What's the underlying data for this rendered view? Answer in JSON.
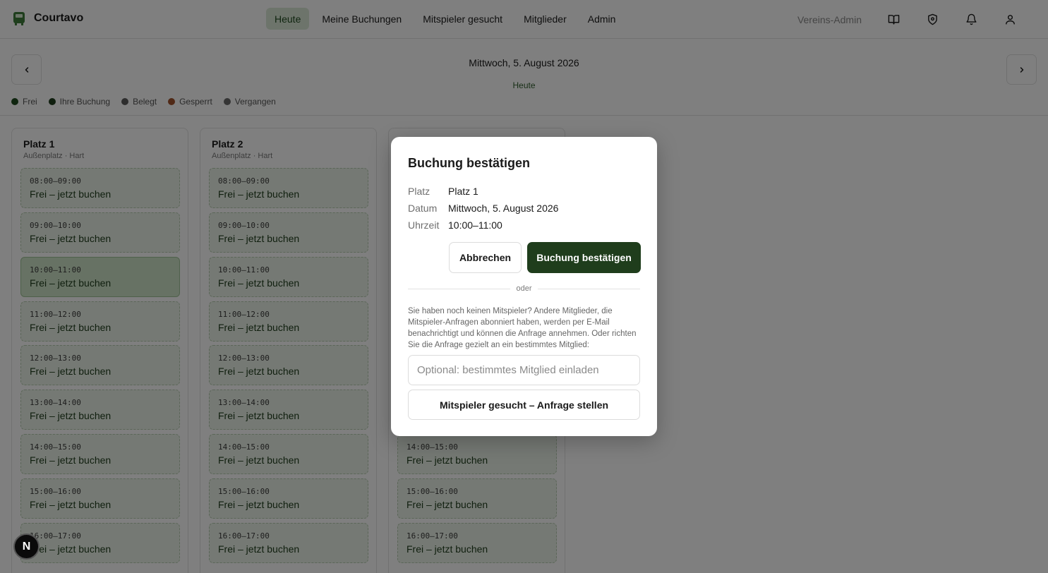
{
  "app": {
    "name": "Courtavo"
  },
  "nav": {
    "links": [
      {
        "label": "Heute",
        "active": true
      },
      {
        "label": "Meine Buchungen",
        "active": false
      },
      {
        "label": "Mitspieler gesucht",
        "active": false
      },
      {
        "label": "Mitglieder",
        "active": false
      },
      {
        "label": "Admin",
        "active": false
      }
    ],
    "role": "Vereins-Admin",
    "icons": [
      "book-icon",
      "shield-icon",
      "bell-icon",
      "user-icon"
    ]
  },
  "datebar": {
    "date": "Mittwoch, 5. August 2026",
    "today_label": "Heute"
  },
  "legend": [
    {
      "label": "Frei",
      "color": "#1f4a1f"
    },
    {
      "label": "Ihre Buchung",
      "color": "#1f3d1c"
    },
    {
      "label": "Belegt",
      "color": "#5a5a5a"
    },
    {
      "label": "Gesperrt",
      "color": "#a0522d"
    },
    {
      "label": "Vergangen",
      "color": "#6a6a6a"
    }
  ],
  "courts": [
    {
      "name": "Platz 1",
      "subtitle": "Außenplatz · Hart",
      "slots": [
        {
          "time": "08:00–09:00",
          "label": "Frei – jetzt buchen"
        },
        {
          "time": "09:00–10:00",
          "label": "Frei – jetzt buchen"
        },
        {
          "time": "10:00–11:00",
          "label": "Frei – jetzt buchen",
          "selected": true
        },
        {
          "time": "11:00–12:00",
          "label": "Frei – jetzt buchen"
        },
        {
          "time": "12:00–13:00",
          "label": "Frei – jetzt buchen"
        },
        {
          "time": "13:00–14:00",
          "label": "Frei – jetzt buchen"
        },
        {
          "time": "14:00–15:00",
          "label": "Frei – jetzt buchen"
        },
        {
          "time": "15:00–16:00",
          "label": "Frei – jetzt buchen"
        },
        {
          "time": "16:00–17:00",
          "label": "Frei – jetzt buchen"
        }
      ]
    },
    {
      "name": "Platz 2",
      "subtitle": "Außenplatz · Hart",
      "slots": [
        {
          "time": "08:00–09:00",
          "label": "Frei – jetzt buchen"
        },
        {
          "time": "09:00–10:00",
          "label": "Frei – jetzt buchen"
        },
        {
          "time": "10:00–11:00",
          "label": "Frei – jetzt buchen"
        },
        {
          "time": "11:00–12:00",
          "label": "Frei – jetzt buchen"
        },
        {
          "time": "12:00–13:00",
          "label": "Frei – jetzt buchen"
        },
        {
          "time": "13:00–14:00",
          "label": "Frei – jetzt buchen"
        },
        {
          "time": "14:00–15:00",
          "label": "Frei – jetzt buchen"
        },
        {
          "time": "15:00–16:00",
          "label": "Frei – jetzt buchen"
        },
        {
          "time": "16:00–17:00",
          "label": "Frei – jetzt buchen"
        }
      ]
    },
    {
      "name": "",
      "subtitle": "",
      "slots": [
        {
          "time": "",
          "label": ""
        },
        {
          "time": "",
          "label": ""
        },
        {
          "time": "",
          "label": ""
        },
        {
          "time": "",
          "label": ""
        },
        {
          "time": "",
          "label": ""
        },
        {
          "time": "",
          "label": ""
        },
        {
          "time": "14:00–15:00",
          "label": "Frei – jetzt buchen"
        },
        {
          "time": "15:00–16:00",
          "label": "Frei – jetzt buchen"
        },
        {
          "time": "16:00–17:00",
          "label": "Frei – jetzt buchen"
        }
      ]
    }
  ],
  "modal": {
    "title": "Buchung bestätigen",
    "rows": [
      {
        "key": "Platz",
        "value": "Platz 1"
      },
      {
        "key": "Datum",
        "value": "Mittwoch, 5. August 2026"
      },
      {
        "key": "Uhrzeit",
        "value": "10:00–11:00"
      }
    ],
    "cancel_label": "Abbrechen",
    "confirm_label": "Buchung bestätigen",
    "divider_label": "oder",
    "description": "Sie haben noch keinen Mitspieler? Andere Mitglieder, die Mitspieler-Anfragen abonniert haben, werden per E-Mail benachrichtigt und können die Anfrage annehmen. Oder richten Sie die Anfrage gezielt an ein bestimmtes Mitglied:",
    "invite_placeholder": "Optional: bestimmtes Mitglied einladen",
    "invite_value": "",
    "request_label": "Mitspieler gesucht – Anfrage stellen"
  },
  "badge": {
    "letter": "N"
  }
}
